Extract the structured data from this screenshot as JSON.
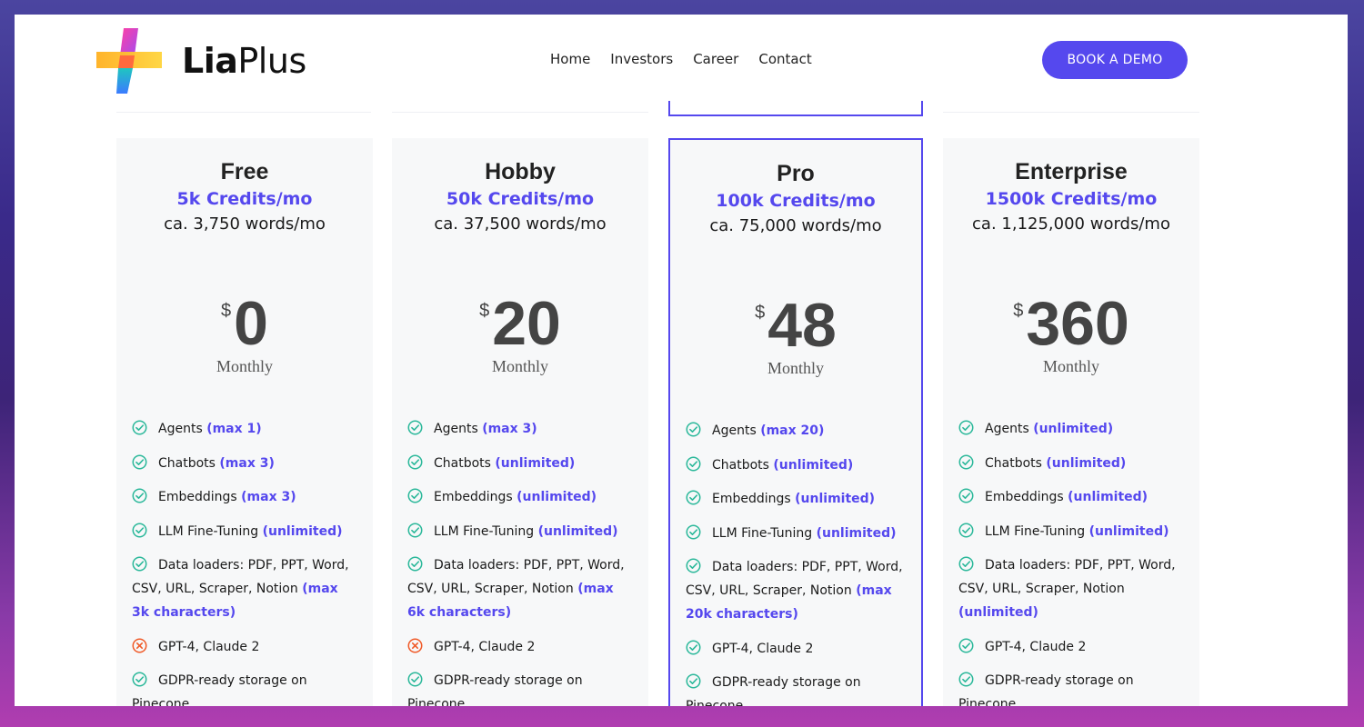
{
  "brand": {
    "name": "LiaPlus",
    "name_strong": "Lia",
    "name_rest": "Plus"
  },
  "nav": {
    "items": [
      "Home",
      "Investors",
      "Career",
      "Contact"
    ]
  },
  "cta": {
    "label": "BOOK A DEMO"
  },
  "colors": {
    "accent": "#5548ee",
    "check": "#2bb89a",
    "cross": "#f05a28"
  },
  "plans": [
    {
      "name": "Free",
      "credits": "5k Credits/mo",
      "words": "ca. 3,750 words/mo",
      "currency": "$",
      "price": "0",
      "period": "Monthly",
      "features": [
        {
          "icon": "check-icon",
          "text": "Agents",
          "hl": "(max 1)"
        },
        {
          "icon": "check-icon",
          "text": "Chatbots",
          "hl": "(max 3)"
        },
        {
          "icon": "check-icon",
          "text": "Embeddings",
          "hl": "(max 3)"
        },
        {
          "icon": "check-icon",
          "text": "LLM Fine-Tuning",
          "hl": "(unlimited)"
        },
        {
          "icon": "check-icon",
          "text": "Data loaders: PDF, PPT, Word, CSV, URL, Scraper, Notion",
          "hl": "(max 3k characters)"
        },
        {
          "icon": "cross-icon",
          "text": "GPT-4, Claude 2",
          "hl": ""
        },
        {
          "icon": "check-icon",
          "text": "GDPR-ready storage on Pinecone",
          "hl": ""
        }
      ]
    },
    {
      "name": "Hobby",
      "credits": "50k Credits/mo",
      "words": "ca. 37,500 words/mo",
      "currency": "$",
      "price": "20",
      "period": "Monthly",
      "features": [
        {
          "icon": "check-icon",
          "text": "Agents",
          "hl": "(max 3)"
        },
        {
          "icon": "check-icon",
          "text": "Chatbots",
          "hl": "(unlimited)"
        },
        {
          "icon": "check-icon",
          "text": "Embeddings",
          "hl": "(unlimited)"
        },
        {
          "icon": "check-icon",
          "text": "LLM Fine-Tuning",
          "hl": "(unlimited)"
        },
        {
          "icon": "check-icon",
          "text": "Data loaders: PDF, PPT, Word, CSV, URL, Scraper, Notion",
          "hl": "(max 6k characters)"
        },
        {
          "icon": "cross-icon",
          "text": "GPT-4, Claude 2",
          "hl": ""
        },
        {
          "icon": "check-icon",
          "text": "GDPR-ready storage on Pinecone",
          "hl": ""
        }
      ]
    },
    {
      "name": "Pro",
      "credits": "100k Credits/mo",
      "words": "ca. 75,000 words/mo",
      "currency": "$",
      "price": "48",
      "period": "Monthly",
      "highlighted": true,
      "features": [
        {
          "icon": "check-icon",
          "text": "Agents",
          "hl": "(max 20)"
        },
        {
          "icon": "check-icon",
          "text": "Chatbots",
          "hl": "(unlimited)"
        },
        {
          "icon": "check-icon",
          "text": "Embeddings",
          "hl": "(unlimited)"
        },
        {
          "icon": "check-icon",
          "text": "LLM Fine-Tuning",
          "hl": "(unlimited)"
        },
        {
          "icon": "check-icon",
          "text": "Data loaders: PDF, PPT, Word, CSV, URL, Scraper, Notion",
          "hl": "(max 20k characters)"
        },
        {
          "icon": "check-icon",
          "text": "GPT-4, Claude 2",
          "hl": ""
        },
        {
          "icon": "check-icon",
          "text": "GDPR-ready storage on Pinecone",
          "hl": ""
        }
      ]
    },
    {
      "name": "Enterprise",
      "credits": "1500k Credits/mo",
      "words": "ca. 1,125,000 words/mo",
      "currency": "$",
      "price": "360",
      "period": "Monthly",
      "features": [
        {
          "icon": "check-icon",
          "text": "Agents",
          "hl": "(unlimited)"
        },
        {
          "icon": "check-icon",
          "text": "Chatbots",
          "hl": "(unlimited)"
        },
        {
          "icon": "check-icon",
          "text": "Embeddings",
          "hl": "(unlimited)"
        },
        {
          "icon": "check-icon",
          "text": "LLM Fine-Tuning",
          "hl": "(unlimited)"
        },
        {
          "icon": "check-icon",
          "text": "Data loaders: PDF, PPT, Word, CSV, URL, Scraper, Notion",
          "hl": "(unlimited)"
        },
        {
          "icon": "check-icon",
          "text": "GPT-4, Claude 2",
          "hl": ""
        },
        {
          "icon": "check-icon",
          "text": "GDPR-ready storage on Pinecone",
          "hl": ""
        }
      ]
    }
  ]
}
